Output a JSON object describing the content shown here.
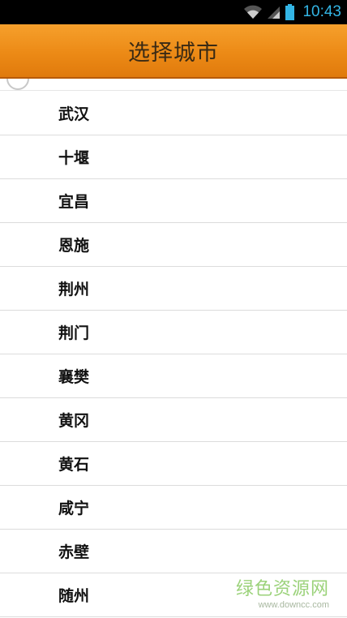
{
  "status_bar": {
    "time": "10:43",
    "icons": [
      "wifi-icon",
      "signal-icon",
      "battery-icon"
    ],
    "accent_color": "#33b5e5"
  },
  "header": {
    "title": "选择城市",
    "background_color": "#ec8a16"
  },
  "refresh": {
    "icon": "refresh-spinner-icon"
  },
  "cities": [
    {
      "label": "武汉"
    },
    {
      "label": "十堰"
    },
    {
      "label": "宜昌"
    },
    {
      "label": "恩施"
    },
    {
      "label": "荆州"
    },
    {
      "label": "荆门"
    },
    {
      "label": "襄樊"
    },
    {
      "label": "黄冈"
    },
    {
      "label": "黄石"
    },
    {
      "label": "咸宁"
    },
    {
      "label": "赤壁"
    },
    {
      "label": "随州"
    }
  ],
  "watermark": {
    "brand": "绿色资源网",
    "url": "www.downcc.com"
  }
}
